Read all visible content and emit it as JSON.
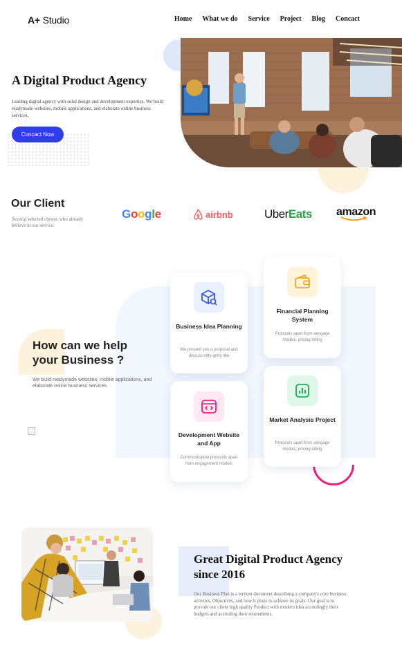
{
  "header": {
    "logo_mark": "A+",
    "logo_text": " Studio",
    "nav": [
      "Home",
      "What we do",
      "Service",
      "Project",
      "Blog",
      "Concact"
    ]
  },
  "hero": {
    "title": "A Digital Product Agency",
    "description": "Leading digital agency with solid design and development expertise. We build readymade websites, mobile applications, and elaborate online business services.",
    "cta": "Concact Now"
  },
  "clients": {
    "title": "Our Client",
    "description": "Several selected clients, who already believe in our service.",
    "logos": {
      "google": [
        "G",
        "o",
        "o",
        "g",
        "l",
        "e"
      ],
      "airbnb": "airbnb",
      "uber": "Uber",
      "eats": "Eats",
      "amazon": "amazon"
    }
  },
  "services": {
    "title_line1": "How can we help",
    "title_line2": "your Business ?",
    "description": "We build readymade websites, mobile applications, and elaborate online business services.",
    "cards": [
      {
        "title": "Business Idea Planning",
        "desc": "We present you a proposal and discuss nitty-gritty like",
        "icon": "box-search-icon"
      },
      {
        "title": "Financial Planning System",
        "desc": "Protocols apart from aengage models, pricing billing",
        "icon": "wallet-icon"
      },
      {
        "title": "Development Website and App",
        "desc": "Communication protocols apart from engagement models",
        "icon": "code-window-icon"
      },
      {
        "title": "Market Analysis Project",
        "desc": "Protocols apart from aengage models, pricing billing",
        "icon": "chart-icon"
      }
    ]
  },
  "about": {
    "title": "Great Digital Product Agency since 2016",
    "description": "Our Business Plan is a written document describing a company's core business activites, Objectives, and how it plans to achieve its goals. Our goal is to provide our client high quality Product with modern idea accordingly their budgets and according their reuirements."
  },
  "colors": {
    "primary": "#2f3ee8",
    "accent_pink": "#f11d7b",
    "soft_blue": "#f2f6fd",
    "soft_yellow": "#fdf3dc"
  }
}
